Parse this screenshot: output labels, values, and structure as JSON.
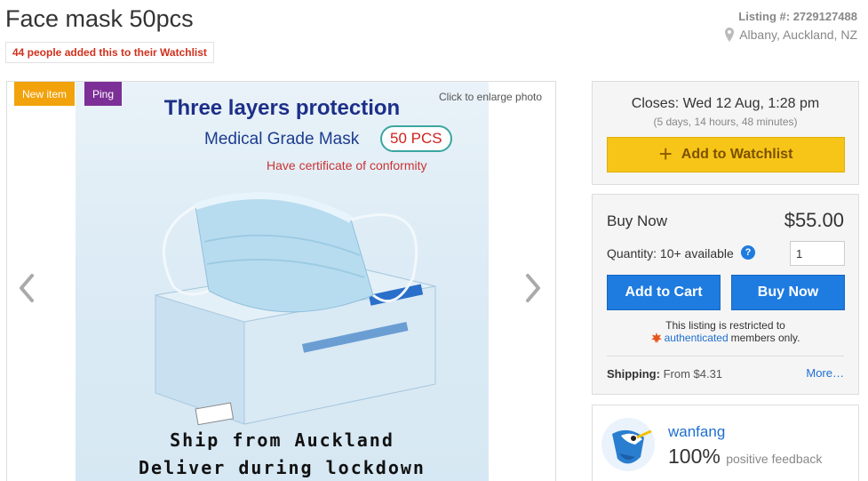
{
  "listing": {
    "title": "Face mask 50pcs",
    "watchlist_badge": "44 people added this to their Watchlist",
    "listing_label": "Listing #:",
    "listing_number": "2729127488",
    "location": "Albany, Auckland, NZ"
  },
  "photo": {
    "tag_new": "New item",
    "tag_ping": "Ping",
    "enlarge": "Click to enlarge photo",
    "headline": "Three layers protection",
    "subline": "Medical Grade Mask",
    "pill": "50 PCS",
    "certificate": "Have certificate of conformity",
    "footer1": "Ship from Auckland",
    "footer2": "Deliver during lockdown"
  },
  "closing": {
    "closes": "Closes: Wed 12 Aug, 1:28 pm",
    "remaining": "(5 days, 14 hours, 48 minutes)",
    "watch_button": "Add to Watchlist"
  },
  "buy": {
    "label": "Buy Now",
    "price": "$55.00",
    "quantity_label": "Quantity: 10+ available",
    "quantity_value": "1",
    "add_to_cart": "Add to Cart",
    "buy_now": "Buy Now",
    "restricted_line1": "This listing is restricted to",
    "restricted_link": "authenticated",
    "restricted_tail": "members only.",
    "shipping_label": "Shipping:",
    "shipping_value": "From $4.31",
    "more": "More…"
  },
  "seller": {
    "name": "wanfang",
    "feedback_pct": "100%",
    "feedback_text": "positive feedback"
  },
  "colors": {
    "watch_yellow": "#f7c518",
    "action_blue": "#1e7be0",
    "badge_red": "#d0311e",
    "new_tag": "#f2a20a",
    "ping_tag": "#7c2f96"
  },
  "icons": [
    "location-pin-icon",
    "chevron-left-icon",
    "chevron-right-icon",
    "plus-icon",
    "help-icon",
    "maple-leaf-icon",
    "kiwi-avatar-icon"
  ]
}
